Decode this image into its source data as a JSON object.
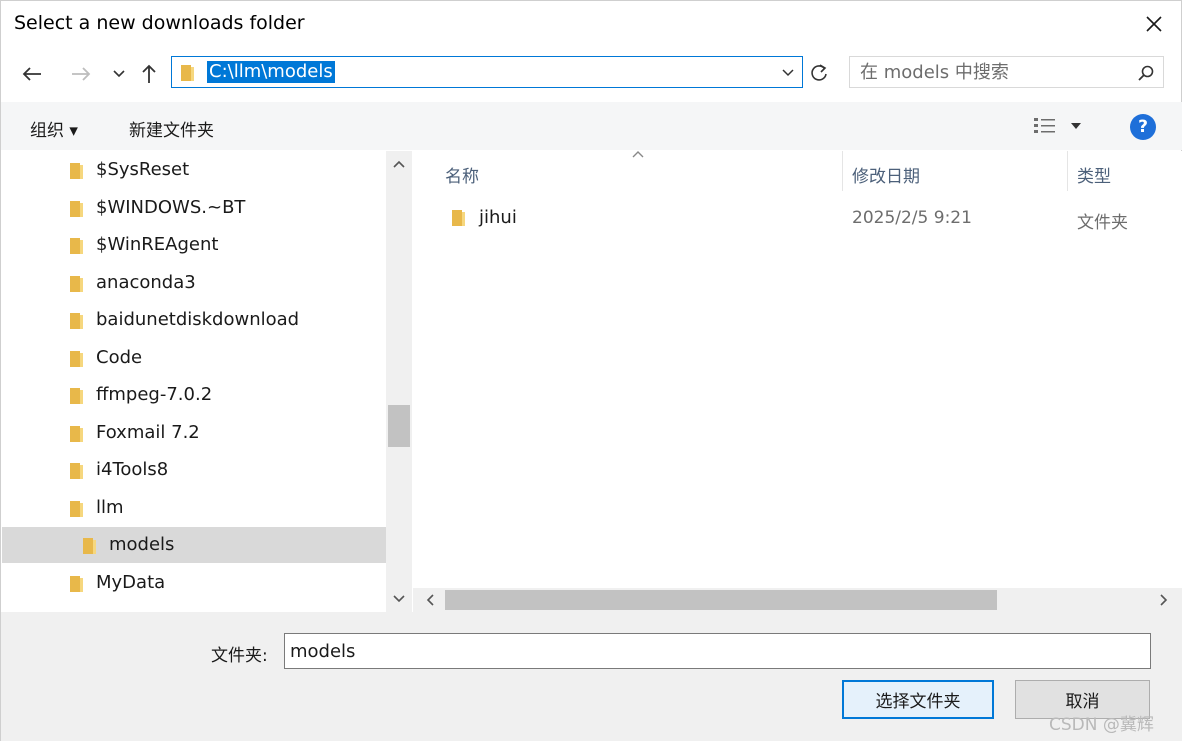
{
  "dialog": {
    "title": "Select a new downloads folder"
  },
  "address": {
    "path": "C:\\llm\\models"
  },
  "search": {
    "placeholder": "在 models 中搜索"
  },
  "toolbar": {
    "organize_label": "组织 ▾",
    "new_folder_label": "新建文件夹"
  },
  "nav_tree": [
    {
      "label": "$SysReset",
      "selected": false,
      "indent": 1
    },
    {
      "label": "$WINDOWS.~BT",
      "selected": false,
      "indent": 1
    },
    {
      "label": "$WinREAgent",
      "selected": false,
      "indent": 1
    },
    {
      "label": "anaconda3",
      "selected": false,
      "indent": 1
    },
    {
      "label": "baidunetdiskdownload",
      "selected": false,
      "indent": 1
    },
    {
      "label": "Code",
      "selected": false,
      "indent": 1
    },
    {
      "label": "ffmpeg-7.0.2",
      "selected": false,
      "indent": 1
    },
    {
      "label": "Foxmail 7.2",
      "selected": false,
      "indent": 1
    },
    {
      "label": "i4Tools8",
      "selected": false,
      "indent": 1
    },
    {
      "label": "llm",
      "selected": false,
      "indent": 1
    },
    {
      "label": "models",
      "selected": true,
      "indent": 2
    },
    {
      "label": "MyData",
      "selected": false,
      "indent": 1
    }
  ],
  "file_list": {
    "columns": {
      "name": "名称",
      "modified": "修改日期",
      "type": "类型"
    },
    "rows": [
      {
        "name": "jihui",
        "modified": "2025/2/5 9:21",
        "type": "文件夹"
      }
    ]
  },
  "footer": {
    "folder_label": "文件夹:",
    "folder_value": "models",
    "select_button": "选择文件夹",
    "cancel_button": "取消",
    "watermark": "CSDN @冀辉"
  },
  "colors": {
    "accent": "#0078d7",
    "folder": "#e8b84a",
    "help": "#1e6fd9"
  }
}
